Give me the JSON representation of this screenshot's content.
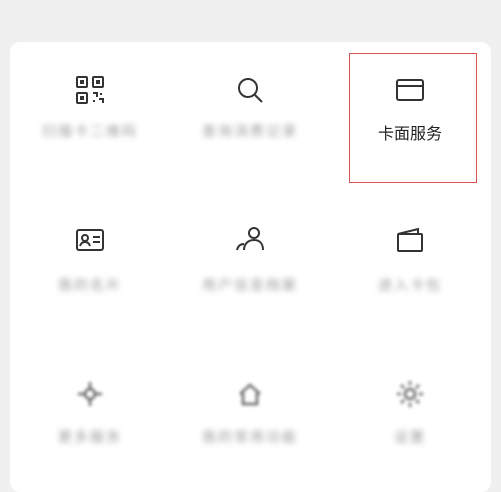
{
  "menu": {
    "items": [
      {
        "id": "qr-code",
        "icon": "qr-code-icon",
        "label": "扫描卡二维码",
        "blurred": true
      },
      {
        "id": "search",
        "icon": "search-icon",
        "label": "查询消费记录",
        "blurred": true
      },
      {
        "id": "card-service",
        "icon": "card-icon",
        "label": "卡面服务",
        "blurred": false
      },
      {
        "id": "id-card",
        "icon": "id-card-icon",
        "label": "我的名片",
        "blurred": true
      },
      {
        "id": "profile",
        "icon": "person-icon",
        "label": "用户信息档案",
        "blurred": true
      },
      {
        "id": "wallet",
        "icon": "wallet-icon",
        "label": "进入卡包",
        "blurred": true
      },
      {
        "id": "feature-7",
        "icon": "puzzle-icon",
        "label": "更多服务",
        "blurred": true
      },
      {
        "id": "feature-8",
        "icon": "home-icon",
        "label": "我的常用功能",
        "blurred": true
      },
      {
        "id": "settings",
        "icon": "gear-icon",
        "label": "设置",
        "blurred": true
      }
    ]
  },
  "highlight": {
    "target": "card-service",
    "color": "#d9534f"
  },
  "colors": {
    "icon": "#333333",
    "text": "#222222",
    "panel": "#ffffff",
    "background": "#f0f0f0"
  }
}
